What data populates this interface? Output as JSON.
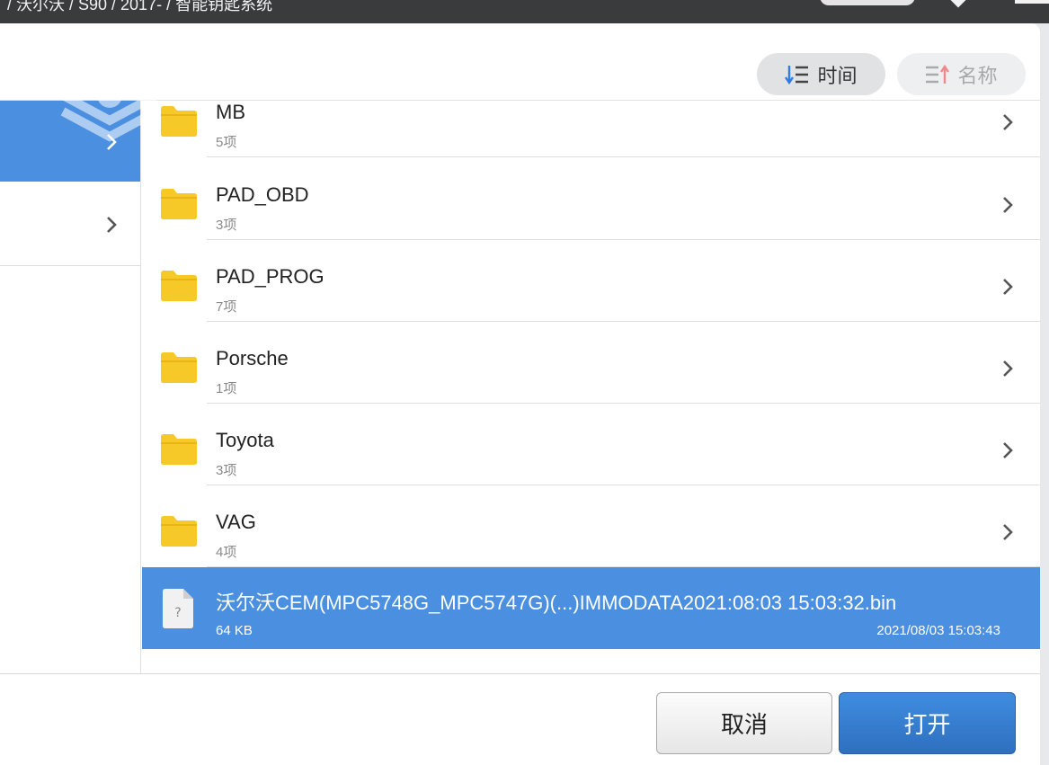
{
  "breadcrumb": "/ 沃尔沃 / S90 / 2017- / 智能钥匙系统",
  "sort": {
    "time_label": "时间",
    "name_label": "名称"
  },
  "folders": [
    {
      "name": "MB",
      "count": "5项"
    },
    {
      "name": "PAD_OBD",
      "count": "3项"
    },
    {
      "name": "PAD_PROG",
      "count": "7项"
    },
    {
      "name": "Porsche",
      "count": "1项"
    },
    {
      "name": "Toyota",
      "count": "3项"
    },
    {
      "name": "VAG",
      "count": "4项"
    }
  ],
  "selected_file": {
    "name": "沃尔沃CEM(MPC5748G_MPC5747G)(...)IMMODATA2021:08:03 15:03:32.bin",
    "size": "64 KB",
    "modified": "2021/08/03 15:03:43"
  },
  "buttons": {
    "cancel": "取消",
    "open": "打开"
  },
  "colors": {
    "accent": "#4a8fe0",
    "folder": "#f7c928",
    "open_button": "#2f75c9"
  },
  "icons": {
    "sort_time": "sort-time-icon",
    "sort_name": "sort-name-icon",
    "folder": "folder-icon",
    "file": "unknown-file-icon",
    "chevron": "chevron-right-icon"
  }
}
